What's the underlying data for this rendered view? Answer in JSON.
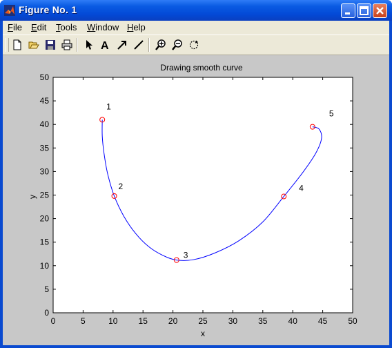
{
  "window": {
    "title": "Figure No. 1",
    "icon": "matlab-icon"
  },
  "menu": [
    {
      "label": "File",
      "key": "F",
      "rest": "ile"
    },
    {
      "label": "Edit",
      "key": "E",
      "rest": "dit"
    },
    {
      "label": "Tools",
      "key": "T",
      "rest": "ools"
    },
    {
      "label": "Window",
      "key": "W",
      "rest": "indow"
    },
    {
      "label": "Help",
      "key": "H",
      "rest": "elp"
    }
  ],
  "toolbar": [
    "new-figure-icon",
    "open-file-icon",
    "save-icon",
    "print-icon",
    "edit-plot-arrow-icon",
    "insert-text-icon",
    "insert-arrow-icon",
    "insert-line-icon",
    "zoom-in-icon",
    "zoom-out-icon",
    "rotate-3d-icon"
  ],
  "chart_data": {
    "type": "line",
    "title": "Drawing smooth curve",
    "xlabel": "x",
    "ylabel": "y",
    "xlim": [
      0,
      50
    ],
    "ylim": [
      0,
      50
    ],
    "xticks": [
      "0",
      "5",
      "10",
      "15",
      "20",
      "25",
      "30",
      "35",
      "40",
      "45",
      "50"
    ],
    "yticks": [
      "0",
      "5",
      "10",
      "15",
      "20",
      "25",
      "30",
      "35",
      "40",
      "45",
      "50"
    ],
    "grid": false,
    "curve_color": "#0000ff",
    "marker_color": "#ff0000",
    "points": [
      {
        "label": "1",
        "x": 8.2,
        "y": 41.0
      },
      {
        "label": "2",
        "x": 10.2,
        "y": 24.8
      },
      {
        "label": "3",
        "x": 20.6,
        "y": 11.2
      },
      {
        "label": "4",
        "x": 38.5,
        "y": 24.7
      },
      {
        "label": "5",
        "x": 43.3,
        "y": 39.5
      }
    ],
    "curve": [
      [
        8.2,
        41.0
      ],
      [
        8.2,
        37.5
      ],
      [
        8.5,
        33.8
      ],
      [
        9.1,
        29.5
      ],
      [
        10.2,
        24.8
      ],
      [
        11.8,
        20.5
      ],
      [
        13.8,
        16.8
      ],
      [
        16.0,
        14.0
      ],
      [
        18.3,
        12.2
      ],
      [
        20.6,
        11.2
      ],
      [
        23.5,
        11.3
      ],
      [
        27.0,
        12.7
      ],
      [
        31.0,
        15.3
      ],
      [
        35.0,
        19.3
      ],
      [
        38.5,
        24.7
      ],
      [
        41.5,
        29.5
      ],
      [
        43.8,
        33.8
      ],
      [
        44.8,
        37.0
      ],
      [
        44.4,
        39.0
      ],
      [
        43.3,
        39.5
      ]
    ]
  }
}
